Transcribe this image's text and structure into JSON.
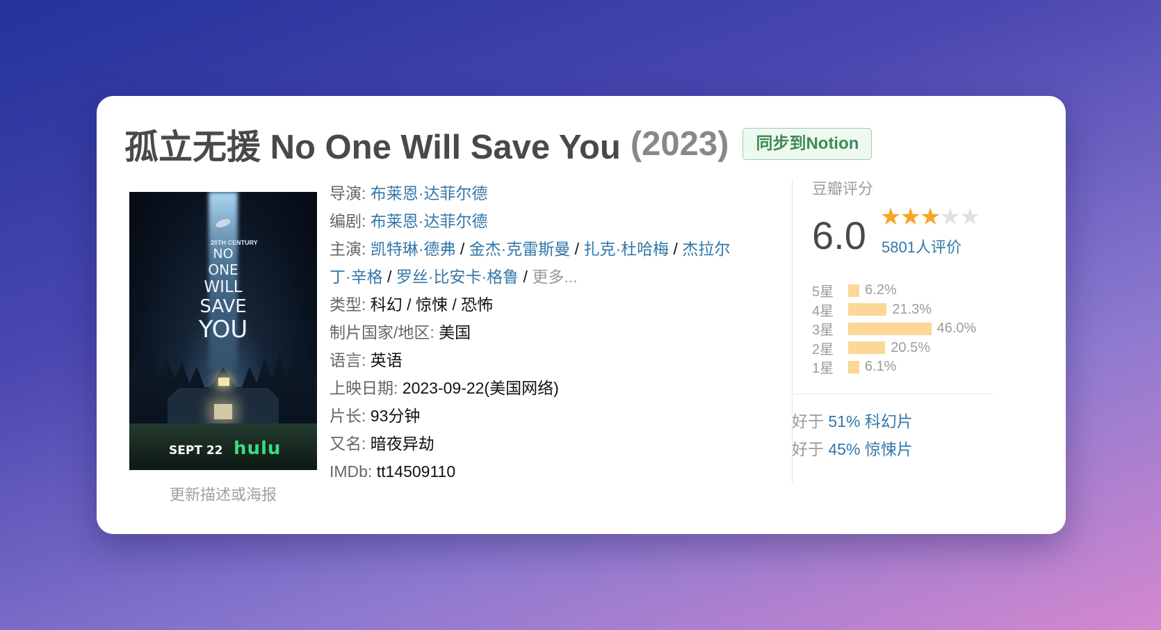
{
  "header": {
    "title": "孤立无援 No One Will Save You",
    "year": "(2023)",
    "sync_button": "同步到Notion"
  },
  "poster": {
    "studio_mark": "20TH CENTURY",
    "title_lines": [
      "NO",
      "ONE",
      "WILL",
      "SAVE",
      "YOU"
    ],
    "release_text": "SEPT 22",
    "platform": "hulu",
    "update_link": "更新描述或海报"
  },
  "info": {
    "director": {
      "label": "导演",
      "names": [
        "布莱恩·达菲尔德"
      ]
    },
    "writer": {
      "label": "编剧",
      "names": [
        "布莱恩·达菲尔德"
      ]
    },
    "cast": {
      "label": "主演",
      "line1": [
        "凯特琳·德弗",
        "金杰·克雷斯曼",
        "扎克·杜哈梅",
        "杰拉尔"
      ],
      "line2": [
        "丁·辛格",
        "罗丝·比安卡·格鲁"
      ],
      "more": "更多..."
    },
    "genre": {
      "label": "类型",
      "value": "科幻 / 惊悚 / 恐怖"
    },
    "country": {
      "label": "制片国家/地区",
      "value": "美国"
    },
    "language": {
      "label": "语言",
      "value": "英语"
    },
    "release": {
      "label": "上映日期",
      "value": "2023-09-22(美国网络)"
    },
    "runtime": {
      "label": "片长",
      "value": "93分钟"
    },
    "aka": {
      "label": "又名",
      "value": "暗夜异劫"
    },
    "imdb": {
      "label": "IMDb",
      "value": "tt14509110"
    }
  },
  "rating": {
    "heading": "豆瓣评分",
    "score": "6.0",
    "stars_filled": 3,
    "stars_total": 5,
    "votes": "5801人评价",
    "distribution": [
      {
        "label": "5星",
        "pct": "6.2%",
        "value": 6.2
      },
      {
        "label": "4星",
        "pct": "21.3%",
        "value": 21.3
      },
      {
        "label": "3星",
        "pct": "46.0%",
        "value": 46.0
      },
      {
        "label": "2星",
        "pct": "20.5%",
        "value": 20.5
      },
      {
        "label": "1星",
        "pct": "6.1%",
        "value": 6.1
      }
    ],
    "better_than": [
      {
        "prefix": "好于",
        "text": "51% 科幻片"
      },
      {
        "prefix": "好于",
        "text": "45% 惊悚片"
      }
    ]
  },
  "colors": {
    "link": "#3377aa",
    "star": "#f6a623",
    "bar": "#fcd797",
    "notion_button_text": "#3f8a55"
  }
}
